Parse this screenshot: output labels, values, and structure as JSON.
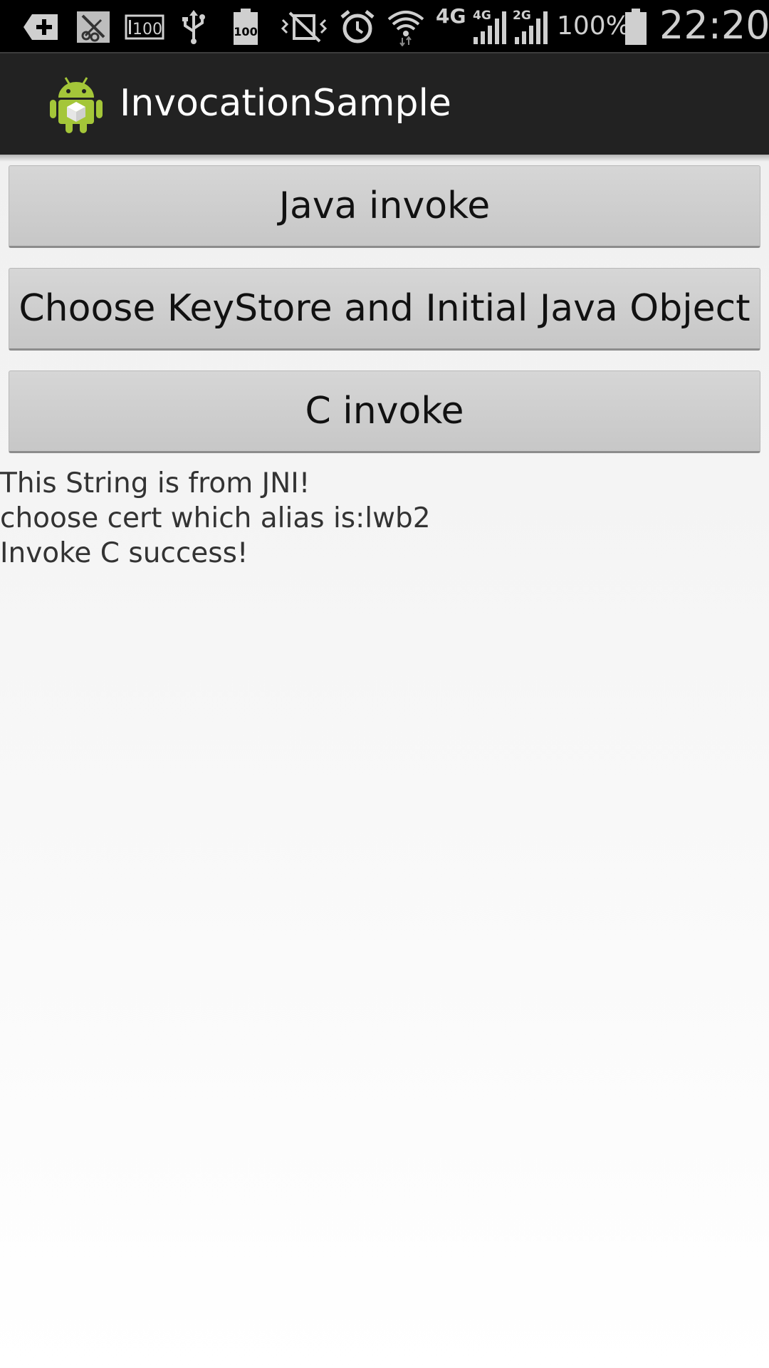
{
  "status_bar": {
    "icons": [
      "add-notification-icon",
      "screenshot-icon",
      "storage-100-icon",
      "usb-icon",
      "battery-100-notice-icon",
      "vibrate-mute-icon",
      "alarm-clock-icon",
      "wifi-icon",
      "signal-4g-icon",
      "signal-2g-icon",
      "battery-icon"
    ],
    "storage_label": "100",
    "battery_notice_label": "100",
    "network_type_main": "4G",
    "network_type_sim1": "4G",
    "network_type_sim2": "2G",
    "battery_percent": "100%",
    "time": "22:20"
  },
  "action_bar": {
    "app_icon": "android-robot-icon",
    "title": "InvocationSample"
  },
  "buttons": {
    "java_invoke": "Java invoke",
    "choose_keystore": "Choose KeyStore and Initial Java Object",
    "c_invoke": "C invoke"
  },
  "output": {
    "lines": [
      "This String is from JNI!",
      "choose cert which alias is:lwb2",
      "Invoke C success!"
    ]
  },
  "colors": {
    "status_bar_bg": "#000000",
    "action_bar_bg": "#222222",
    "android_green": "#a4c639",
    "button_bg": "#cccccc",
    "body_text": "#333333"
  }
}
